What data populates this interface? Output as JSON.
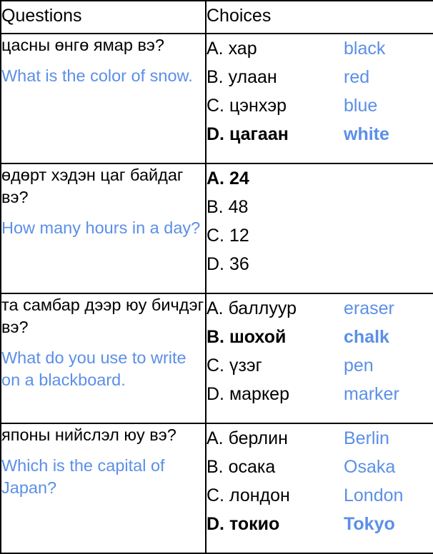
{
  "table": {
    "headers": {
      "questions": "Questions",
      "choices": "Choices"
    },
    "accent_color": "#5b8fe8",
    "text_color": "#000000",
    "border_color": "#000000",
    "rows": [
      {
        "question_native": "цасны өнгө ямар вэ?",
        "question_english": "What is the color of snow.",
        "choices": [
          {
            "label": "A.",
            "native": "хар",
            "english": "black",
            "correct": false
          },
          {
            "label": "B.",
            "native": "улаан",
            "english": "red",
            "correct": false
          },
          {
            "label": "C.",
            "native": "цэнхэр",
            "english": "blue",
            "correct": false
          },
          {
            "label": "D.",
            "native": "цагаан",
            "english": "white",
            "correct": true
          }
        ]
      },
      {
        "question_native": "өдөрт хэдэн цаг байдаг вэ?",
        "question_english": "How many hours in a day?",
        "choices": [
          {
            "label": "A.",
            "native": "24",
            "english": "",
            "correct": true
          },
          {
            "label": "B.",
            "native": "48",
            "english": "",
            "correct": false
          },
          {
            "label": "C.",
            "native": "12",
            "english": "",
            "correct": false
          },
          {
            "label": "D.",
            "native": "36",
            "english": "",
            "correct": false
          }
        ]
      },
      {
        "question_native": "та самбар дээр юу бичдэг вэ?",
        "question_english": "What do you use to write on a blackboard.",
        "choices": [
          {
            "label": "A.",
            "native": "баллуур",
            "english": "eraser",
            "correct": false
          },
          {
            "label": "B.",
            "native": "шохой",
            "english": "chalk",
            "correct": true
          },
          {
            "label": "C.",
            "native": "үзэг",
            "english": "pen",
            "correct": false
          },
          {
            "label": "D.",
            "native": "маркер",
            "english": "marker",
            "correct": false
          }
        ]
      },
      {
        "question_native": "японы нийслэл юу вэ?",
        "question_english": "Which is the capital of Japan?",
        "choices": [
          {
            "label": "A.",
            "native": "берлин",
            "english": "Berlin",
            "correct": false
          },
          {
            "label": "B.",
            "native": "осака",
            "english": "Osaka",
            "correct": false
          },
          {
            "label": "C.",
            "native": "лондон",
            "english": "London",
            "correct": false
          },
          {
            "label": "D.",
            "native": "токио",
            "english": "Tokyo",
            "correct": true
          }
        ]
      }
    ]
  }
}
